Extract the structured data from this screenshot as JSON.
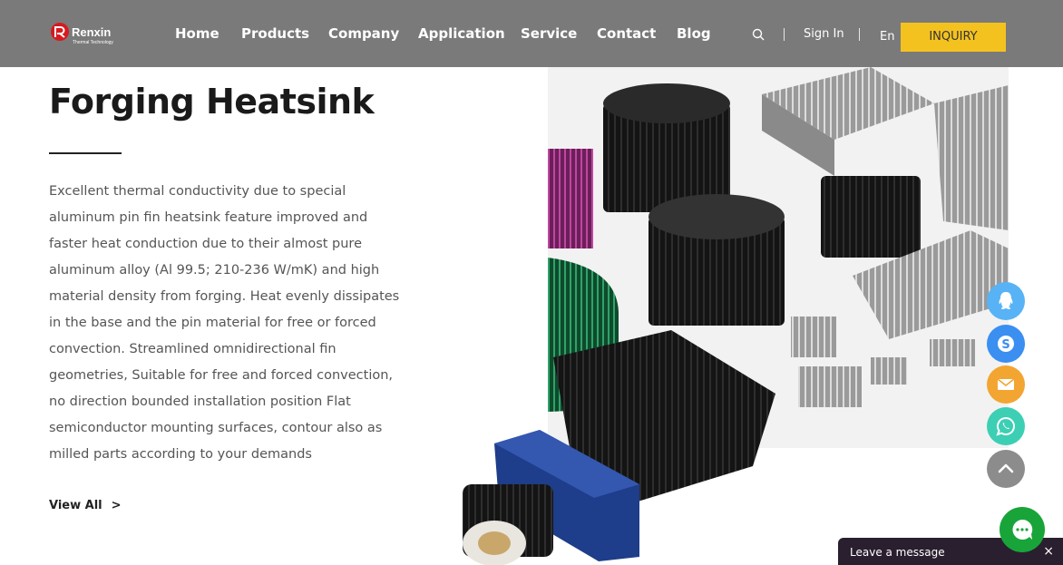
{
  "header": {
    "brand": "Renxin",
    "brand_sub": "Thermal Technology",
    "nav": [
      "Home",
      "Products",
      "Company",
      "Application",
      "Service",
      "Contact",
      "Blog"
    ],
    "sign_in": "Sign In",
    "language": "En",
    "inquiry": "INQUIRY"
  },
  "main": {
    "title": "Forging Heatsink",
    "description_lines": [
      "Excellent thermal conductivity due to special",
      "aluminum pin fin heatsink feature improved and",
      "faster heat conduction due to their almost pure",
      "aluminum alloy (Al 99.5; 210-236 W/mK) and high",
      "material density from forging. Heat evenly dissipates",
      "in the base and the pin material for free or forced",
      "convection. Streamlined omnidirectional fin",
      "geometries, Suitable for free and forced convection,",
      "no direction bounded installation position Flat",
      "semiconductor mounting surfaces, contour also as",
      "milled parts according to your demands"
    ],
    "view_all": "View All",
    "view_all_arrow": ">"
  },
  "floating": {
    "icons": [
      "qq-icon",
      "skype-icon",
      "email-icon",
      "whatsapp-icon",
      "back-to-top-icon"
    ],
    "colors": {
      "qq": "#57b3f5",
      "skype": "#3a8ff0",
      "email": "#f3a531",
      "whatsapp": "#3ccfb4",
      "top": "#8c8c8c"
    }
  },
  "chat": {
    "leave_message": "Leave a message",
    "close": "×",
    "color": "#19a43a"
  },
  "colors": {
    "header_bg": "#7a7a7a",
    "inquiry_bg": "#f4c21f"
  }
}
